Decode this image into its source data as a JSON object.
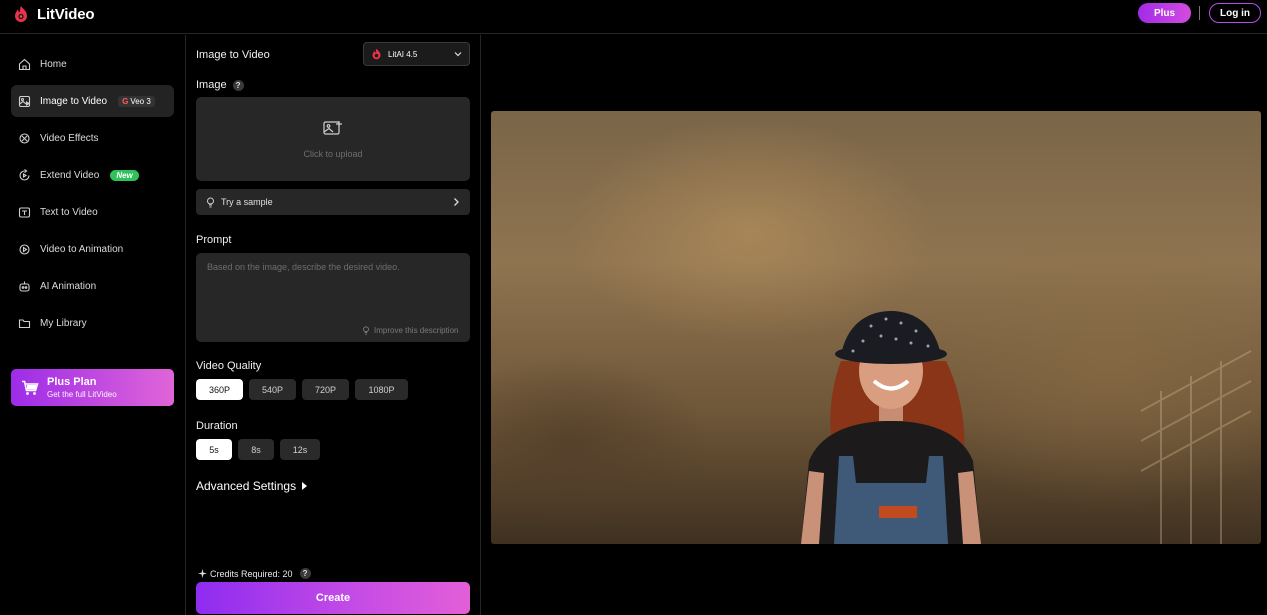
{
  "app": {
    "name": "LitVideo"
  },
  "header": {
    "plus_label": "Plus",
    "login_label": "Log in"
  },
  "sidebar": {
    "items": [
      {
        "label": "Home",
        "icon": "home-icon"
      },
      {
        "label": "Image to Video",
        "icon": "image-to-video-icon",
        "badge": "Veo 3",
        "badge_g": "G"
      },
      {
        "label": "Video Effects",
        "icon": "video-effects-icon"
      },
      {
        "label": "Extend Video",
        "icon": "extend-video-icon",
        "badge": "New"
      },
      {
        "label": "Text to Video",
        "icon": "text-to-video-icon"
      },
      {
        "label": "Video to Animation",
        "icon": "video-to-animation-icon"
      },
      {
        "label": "AI Animation",
        "icon": "ai-animation-icon"
      },
      {
        "label": "My Library",
        "icon": "folder-icon"
      }
    ],
    "plus_card": {
      "title": "Plus Plan",
      "subtitle": "Get the full LitVideo"
    }
  },
  "form": {
    "title": "Image to Video",
    "model": "LitAI 4.5",
    "image_label": "Image",
    "help_glyph": "?",
    "upload_text": "Click to upload",
    "sample_label": "Try a sample",
    "prompt_label": "Prompt",
    "prompt_placeholder": "Based on the image, describe the desired video.",
    "improve_label": "Improve this description",
    "quality_label": "Video Quality",
    "quality_options": [
      "360P",
      "540P",
      "720P",
      "1080P"
    ],
    "quality_selected": "360P",
    "duration_label": "Duration",
    "duration_options": [
      "5s",
      "8s",
      "12s"
    ],
    "duration_selected": "5s",
    "advanced_label": "Advanced Settings",
    "credits_label": "Credits Required: 20",
    "create_label": "Create"
  },
  "colors": {
    "accent_start": "#9d2ce8",
    "accent_end": "#e065d8",
    "new_badge": "#2fc15a",
    "panel_bg": "#272727"
  }
}
